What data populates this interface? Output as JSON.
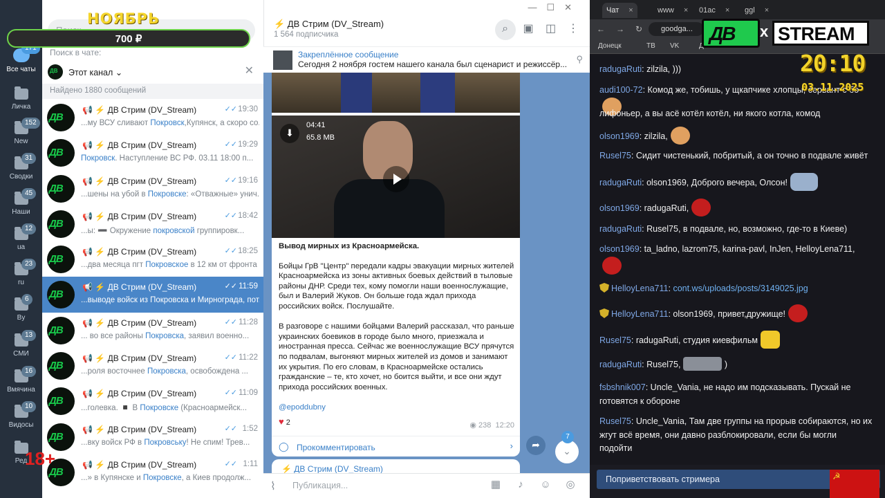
{
  "overlay": {
    "month": "НОЯБРЬ",
    "goal": "700 ₽",
    "age": "18+",
    "clock": "20:10",
    "date": "03.11.2025"
  },
  "folders": [
    {
      "label": "Все чаты",
      "badge": "171"
    },
    {
      "label": "Личка",
      "badge": ""
    },
    {
      "label": "New",
      "badge": "152"
    },
    {
      "label": "Сводки",
      "badge": "31"
    },
    {
      "label": "Наши",
      "badge": "45"
    },
    {
      "label": "ua",
      "badge": "12"
    },
    {
      "label": "ru",
      "badge": "23"
    },
    {
      "label": "By",
      "badge": "6"
    },
    {
      "label": "СМИ",
      "badge": "13"
    },
    {
      "label": "Вмячина",
      "badge": "16"
    },
    {
      "label": "Видосы",
      "badge": "10"
    },
    {
      "label": "Ред",
      "badge": ""
    }
  ],
  "chatlist": {
    "search_placeholder": "Поиск",
    "search_in_chat": "Поиск в чате:",
    "this_channel": "Этот канал",
    "found": "Найдено 1880 сообщений",
    "rows": [
      {
        "name": "⚡ ДВ Стрим (DV_Stream)",
        "time": "19:30",
        "pre": "...му ВСУ сливают ",
        "hl": "Покровск",
        "post": ",Купянск, а скоро со..."
      },
      {
        "name": "⚡ ДВ Стрим (DV_Stream)",
        "time": "19:29",
        "pre": "",
        "hl": "Покровск",
        "post": ". Наступление ВС РФ. 03.11 18:00 п..."
      },
      {
        "name": "⚡ ДВ Стрим (DV_Stream)",
        "time": "19:16",
        "pre": "...шены на убой в ",
        "hl": "Покровске",
        "post": ": «Отважные» унич..."
      },
      {
        "name": "⚡ ДВ Стрим (DV_Stream)",
        "time": "18:42",
        "pre": "...ы: ➖ Окружение ",
        "hl": "покровской",
        "post": " группировк..."
      },
      {
        "name": "⚡ ДВ Стрим (DV_Stream)",
        "time": "18:25",
        "pre": "...два месяца пгт ",
        "hl": "Покровское",
        "post": " в 12 км от фронта ..."
      },
      {
        "name": "⚡ ДВ Стрим (DV_Stream)",
        "time": "11:59",
        "pre": "...выводе войск из ",
        "hl": "Покровска",
        "post": " и Мирнограда, пот..."
      },
      {
        "name": "⚡ ДВ Стрим (DV_Stream)",
        "time": "11:28",
        "pre": "... во все районы ",
        "hl": "Покровска",
        "post": ", заявил военно..."
      },
      {
        "name": "⚡ ДВ Стрим (DV_Stream)",
        "time": "11:22",
        "pre": "...роля восточнее ",
        "hl": "Покровска",
        "post": ", освобожденa ..."
      },
      {
        "name": "⚡ ДВ Стрим (DV_Stream)",
        "time": "11:09",
        "pre": "...голевка. ◾ В ",
        "hl": "Покровске",
        "post": " (Красноармейск..."
      },
      {
        "name": "⚡ ДВ Стрим (DV_Stream)",
        "time": "1:52",
        "pre": "...вку войск РФ в ",
        "hl": "Покровську",
        "post": "! Не спим! Трев..."
      },
      {
        "name": "⚡ ДВ Стрим (DV_Stream)",
        "time": "1:11",
        "pre": "...» в Купянске и ",
        "hl": "Покровске",
        "post": ", а Киев продолж..."
      }
    ]
  },
  "channel": {
    "title": "⚡ ДВ Стрим (DV_Stream)",
    "subs": "1 564 подписчика",
    "pinned_title": "Закреплённое сообщение",
    "pinned_text": "Сегодня 2 ноября гостем нашего канала был сценарист и режиссёр...",
    "video_duration": "04:41",
    "video_size": "65.8 MB",
    "post_title": "Вывод мирных из Красноармейска.",
    "post_p1": "Бойцы ГрВ \"Центр\" передали кадры эвакуации мирных жителей Красноармейска из зоны активных боевых действий в тыловые районы ДНР.  Среди тех, кому помогли наши военнослужащие, был и Валерий Жуков. Он больше года ждал прихода российских войск. Послушайте.",
    "post_p2": "В разговоре с нашими бойцами Валерий рассказал, что раньше украинских боевиков в городе было много, приезжала и иностранная пресса. Сейчас же военнослужащие ВСУ прячутся по подвалам, выгоняют мирных жителей из домов и занимают их укрытия. По его словам, в Красноармейске остались гражданские – те, кто хочет, но боится выйти, и все они ждут прихода российских военных.",
    "post_link": "@epoddubny",
    "reactions": "2",
    "views": "238",
    "post_time": "12:20",
    "comment": "Прокомментировать",
    "next_post": "⚡ ДВ Стрим (DV_Stream)",
    "unread": "7",
    "composer_placeholder": "Публикация..."
  },
  "browser": {
    "tabs": [
      "Чат",
      "www",
      "01ac",
      "ggl"
    ],
    "url": "goodga...",
    "bookmarks": [
      "Донецк",
      "ТВ",
      "VK",
      "ДВ"
    ]
  },
  "logo": {
    "left": "ДВ",
    "x": "x",
    "right": "STREAM"
  },
  "chat": [
    {
      "user": "radugaRuti",
      "text": ": zilzila, )))"
    },
    {
      "user": "audi100-72",
      "text": ": Комод же, тобишь, у щкапчике хлопцы, сервант с бо"
    },
    {
      "user": "",
      "text": "лифоньер, а вы асё котёл котёл, ни якого котла, комод"
    },
    {
      "user": "olson1969",
      "text": ": zilzila,"
    },
    {
      "user": "Rusel75",
      "text": ": Сидит чистенький, побритый, а он точно в подвале живёт"
    },
    {
      "user": "radugaRuti",
      "text": ": olson1969, Доброго вечера, Олсон!"
    },
    {
      "user": "olson1969",
      "text": ": radugaRuti,"
    },
    {
      "user": "radugaRuti",
      "text": ": Rusel75, в подвале, но, возможно, где-то в Киеве)"
    },
    {
      "user": "olson1969",
      "text": ": ta_ladno, lazrom75, karina-pavl, InJen, HelloyLena711,"
    },
    {
      "user": "HelloyLena711",
      "text": ": ",
      "link": "cont.ws/uploads/posts/3149025.jpg"
    },
    {
      "user": "HelloyLena711",
      "text": ": olson1969, привет,дружище!"
    },
    {
      "user": "Rusel75",
      "text": ": radugaRuti, студия киевфильм"
    },
    {
      "user": "radugaRuti",
      "text": ": Rusel75,"
    },
    {
      "user": "fsbshnik007",
      "text": ": Uncle_Vania, не надо им подсказывать. Пускай не"
    },
    {
      "user": "",
      "text": "готовятся к обороне"
    },
    {
      "user": "Rusel75",
      "text": ": Uncle_Vania, Там две группы на прорыв собираются, но их"
    },
    {
      "user": "",
      "text": "жгут всё время, они давно разблокировали, если бы могли"
    },
    {
      "user": "",
      "text": "подойти"
    }
  ],
  "greet": "Поприветствовать стримера"
}
